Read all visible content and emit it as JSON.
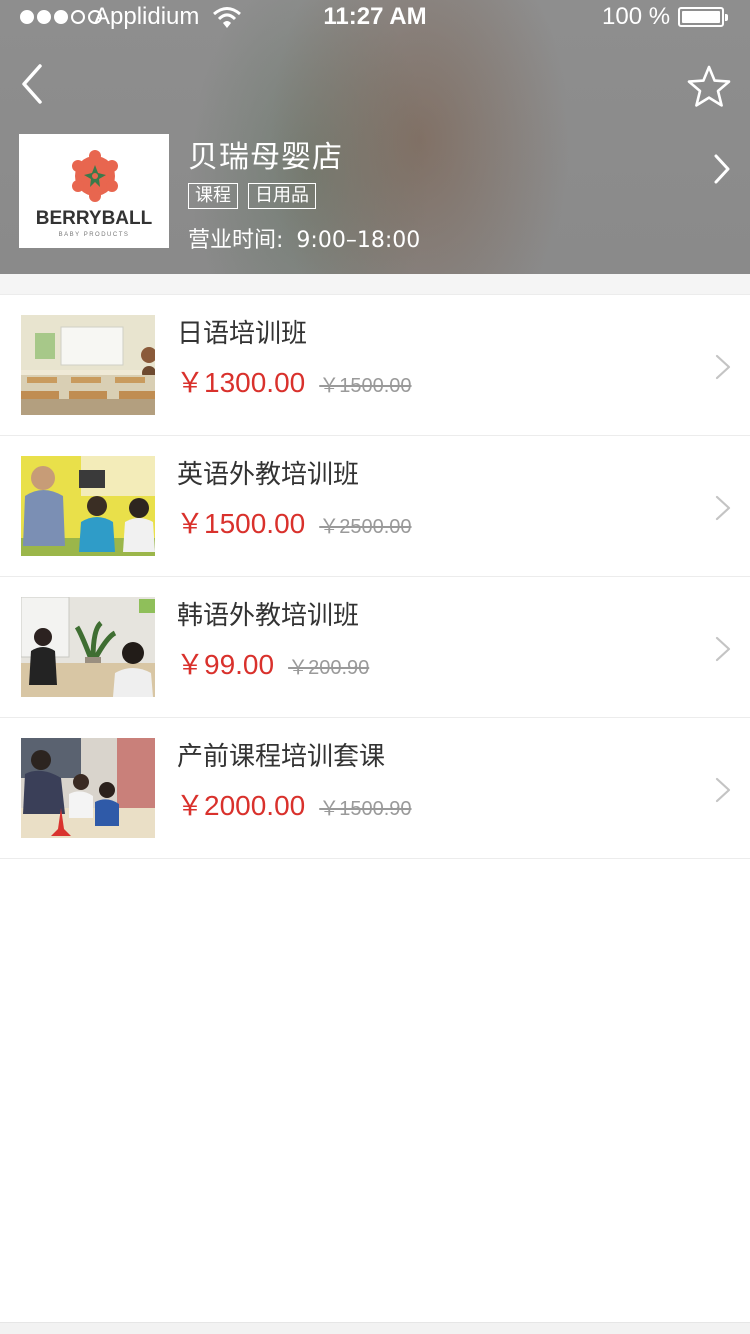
{
  "status_bar": {
    "carrier": "Applidium",
    "time": "11:27 AM",
    "battery": "100 %"
  },
  "header": {
    "back_icon": "chevron-left-icon",
    "favorite_icon": "star-outline-icon",
    "store": {
      "logo_text": "BERRYBALL",
      "logo_subtext": "BABY PRODUCTS",
      "name": "贝瑞母婴店",
      "tags": [
        "课程",
        "日用品"
      ],
      "hours_label": "营业时间:",
      "hours_value": "9:00–18:00"
    }
  },
  "courses": [
    {
      "title": "日语培训班",
      "price": "￥1300.00",
      "original_price": "￥1500.00"
    },
    {
      "title": "英语外教培训班",
      "price": "￥1500.00",
      "original_price": "￥2500.00"
    },
    {
      "title": "韩语外教培训班",
      "price": "￥99.00",
      "original_price": "￥200.90"
    },
    {
      "title": "产前课程培训套课",
      "price": "￥2000.00",
      "original_price": "￥1500.90"
    }
  ],
  "colors": {
    "price_red": "#d9312c",
    "header_gray": "#8e8e8e",
    "logo_orange": "#e8664f"
  }
}
